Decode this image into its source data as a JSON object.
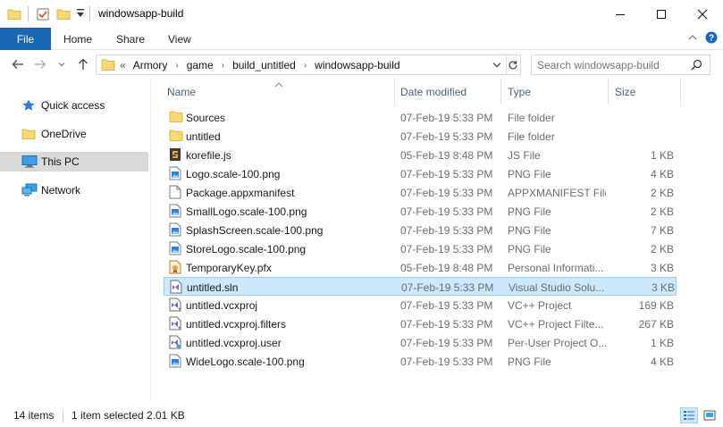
{
  "window": {
    "title": "windowsapp-build"
  },
  "ribbon": {
    "tabs": [
      {
        "label": "File"
      },
      {
        "label": "Home"
      },
      {
        "label": "Share"
      },
      {
        "label": "View"
      }
    ]
  },
  "address": {
    "overflow": "«",
    "crumbs": [
      "Armory",
      "game",
      "build_untitled",
      "windowsapp-build"
    ]
  },
  "search": {
    "placeholder": "Search windowsapp-build"
  },
  "nav": {
    "items": [
      {
        "label": "Quick access",
        "icon": "star-icon"
      },
      {
        "label": "OneDrive",
        "icon": "folder-icon"
      },
      {
        "label": "This PC",
        "icon": "computer-icon",
        "selected": true
      },
      {
        "label": "Network",
        "icon": "network-icon"
      }
    ]
  },
  "columns": {
    "name": "Name",
    "date": "Date modified",
    "type": "Type",
    "size": "Size"
  },
  "files": [
    {
      "name": "Sources",
      "date": "07-Feb-19 5:33 PM",
      "type": "File folder",
      "size": "",
      "icon": "folder"
    },
    {
      "name": "untitled",
      "date": "07-Feb-19 5:33 PM",
      "type": "File folder",
      "size": "",
      "icon": "folder"
    },
    {
      "name": "korefile.js",
      "date": "05-Feb-19 8:48 PM",
      "type": "JS File",
      "size": "1 KB",
      "icon": "js"
    },
    {
      "name": "Logo.scale-100.png",
      "date": "07-Feb-19 5:33 PM",
      "type": "PNG File",
      "size": "4 KB",
      "icon": "image"
    },
    {
      "name": "Package.appxmanifest",
      "date": "07-Feb-19 5:33 PM",
      "type": "APPXMANIFEST File",
      "size": "2 KB",
      "icon": "blank"
    },
    {
      "name": "SmallLogo.scale-100.png",
      "date": "07-Feb-19 5:33 PM",
      "type": "PNG File",
      "size": "2 KB",
      "icon": "image"
    },
    {
      "name": "SplashScreen.scale-100.png",
      "date": "07-Feb-19 5:33 PM",
      "type": "PNG File",
      "size": "7 KB",
      "icon": "image"
    },
    {
      "name": "StoreLogo.scale-100.png",
      "date": "07-Feb-19 5:33 PM",
      "type": "PNG File",
      "size": "2 KB",
      "icon": "image"
    },
    {
      "name": "TemporaryKey.pfx",
      "date": "05-Feb-19 8:48 PM",
      "type": "Personal Informati...",
      "size": "3 KB",
      "icon": "cert"
    },
    {
      "name": "untitled.sln",
      "date": "07-Feb-19 5:33 PM",
      "type": "Visual Studio Solu...",
      "size": "3 KB",
      "icon": "sln",
      "selected": true
    },
    {
      "name": "untitled.vcxproj",
      "date": "07-Feb-19 5:33 PM",
      "type": "VC++ Project",
      "size": "169 KB",
      "icon": "vcx"
    },
    {
      "name": "untitled.vcxproj.filters",
      "date": "07-Feb-19 5:33 PM",
      "type": "VC++ Project Filte...",
      "size": "267 KB",
      "icon": "vcx"
    },
    {
      "name": "untitled.vcxproj.user",
      "date": "07-Feb-19 5:33 PM",
      "type": "Per-User Project O...",
      "size": "1 KB",
      "icon": "user"
    },
    {
      "name": "WideLogo.scale-100.png",
      "date": "07-Feb-19 5:33 PM",
      "type": "PNG File",
      "size": "4 KB",
      "icon": "image"
    }
  ],
  "status": {
    "items_count": "14 items",
    "selection": "1 item selected",
    "selection_size": "2.01 KB"
  },
  "colors": {
    "accent": "#1a66b5",
    "selection_bg": "#cce8ff",
    "selection_border": "#99d1ff",
    "folder": "#f8d775",
    "header_text": "#4c607a"
  }
}
